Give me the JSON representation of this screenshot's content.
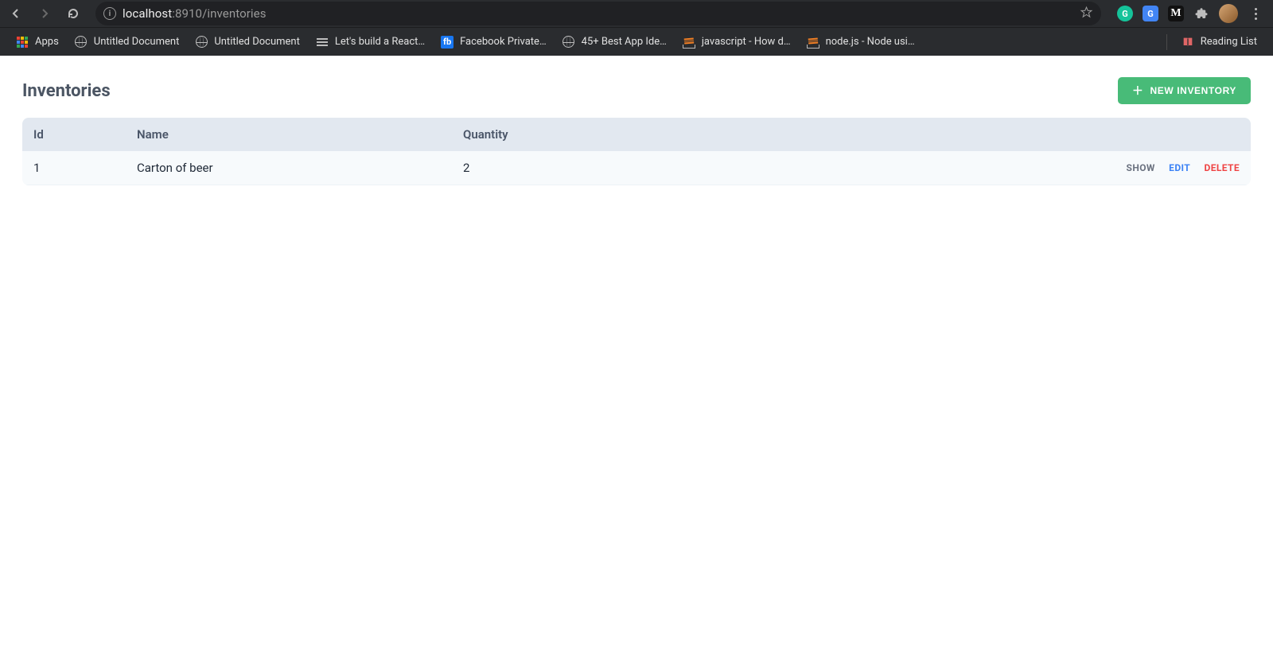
{
  "browser": {
    "url_host": "localhost",
    "url_rest": ":8910/inventories",
    "bookmarks": [
      {
        "icon": "apps",
        "label": "Apps"
      },
      {
        "icon": "globe",
        "label": "Untitled Document"
      },
      {
        "icon": "globe",
        "label": "Untitled Document"
      },
      {
        "icon": "list",
        "label": "Let's build a React…"
      },
      {
        "icon": "fb",
        "label": "Facebook Private…"
      },
      {
        "icon": "globe",
        "label": "45+ Best App Ide…"
      },
      {
        "icon": "so",
        "label": "javascript - How d…"
      },
      {
        "icon": "so",
        "label": "node.js - Node usi…"
      }
    ],
    "reading_list_label": "Reading List"
  },
  "page": {
    "title": "Inventories",
    "new_button_label": "NEW INVENTORY",
    "columns": {
      "id": "Id",
      "name": "Name",
      "quantity": "Quantity"
    },
    "actions": {
      "show": "SHOW",
      "edit": "EDIT",
      "delete": "DELETE"
    },
    "rows": [
      {
        "id": "1",
        "name": "Carton of beer",
        "quantity": "2"
      }
    ]
  }
}
